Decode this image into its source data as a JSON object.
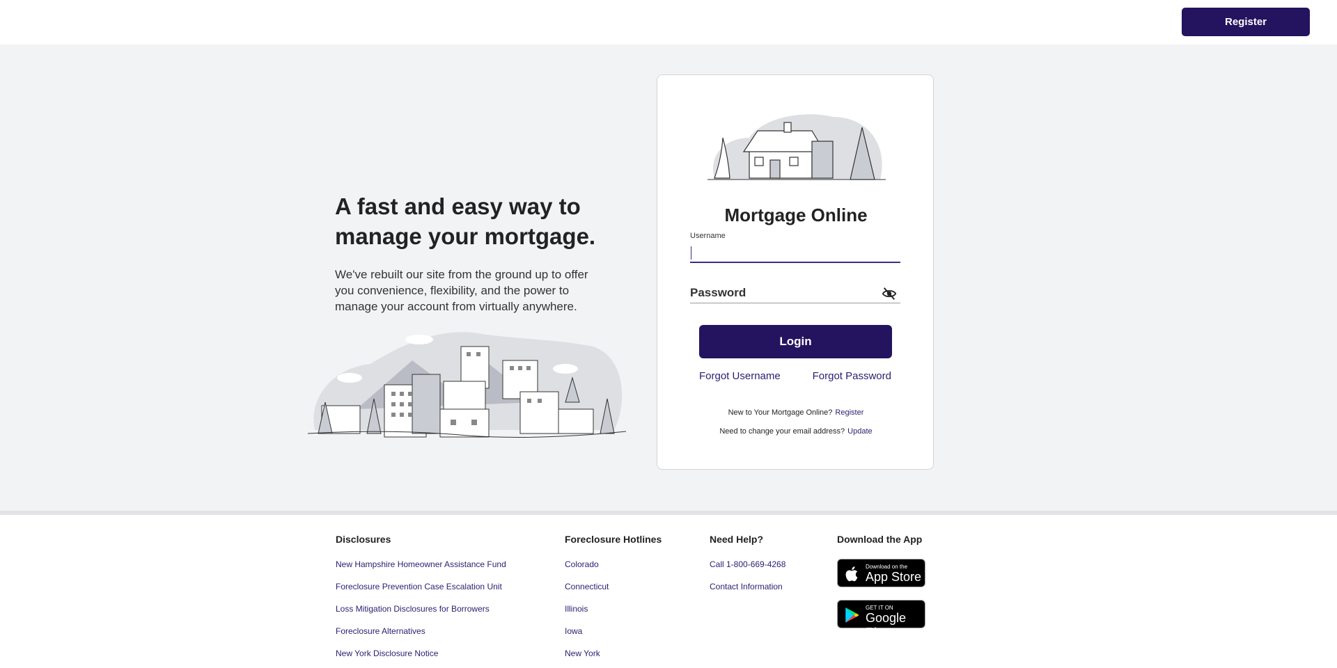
{
  "header": {
    "register_label": "Register"
  },
  "hero": {
    "headline": "A fast and easy way to manage your mortgage.",
    "subtext": "We've rebuilt our site from the ground up to offer you convenience, flexibility, and the power to manage your account from virtually anywhere."
  },
  "login": {
    "title": "Mortgage Online",
    "username_label": "Username",
    "username_value": "",
    "password_label": "Password",
    "password_value": "",
    "login_label": "Login",
    "forgot_username": "Forgot Username",
    "forgot_password": "Forgot Password",
    "new_user_text": "New to Your Mortgage Online?",
    "new_user_link": "Register",
    "email_text": "Need to change your email address?",
    "email_link": "Update"
  },
  "footer": {
    "disclosures": {
      "heading": "Disclosures",
      "links": [
        "New Hampshire Homeowner Assistance Fund",
        "Foreclosure Prevention Case Escalation Unit",
        "Loss Mitigation Disclosures for Borrowers",
        "Foreclosure Alternatives",
        "New York Disclosure Notice"
      ]
    },
    "hotlines": {
      "heading": "Foreclosure Hotlines",
      "links": [
        "Colorado",
        "Connecticut",
        "Illinois",
        "Iowa",
        "New York"
      ]
    },
    "help": {
      "heading": "Need Help?",
      "links": [
        "Call 1-800-669-4268",
        "Contact Information"
      ]
    },
    "app": {
      "heading": "Download the App",
      "appstore_small": "Download on the",
      "appstore_big": "App Store",
      "googleplay_small": "GET IT ON",
      "googleplay_big": "Google Play"
    }
  },
  "colors": {
    "primary": "#24135f",
    "link": "#2b1d6e",
    "background": "#f2f3f5"
  },
  "icons": {
    "password_toggle": "eye-off-icon",
    "apple": "apple-icon",
    "google_play": "google-play-icon"
  }
}
